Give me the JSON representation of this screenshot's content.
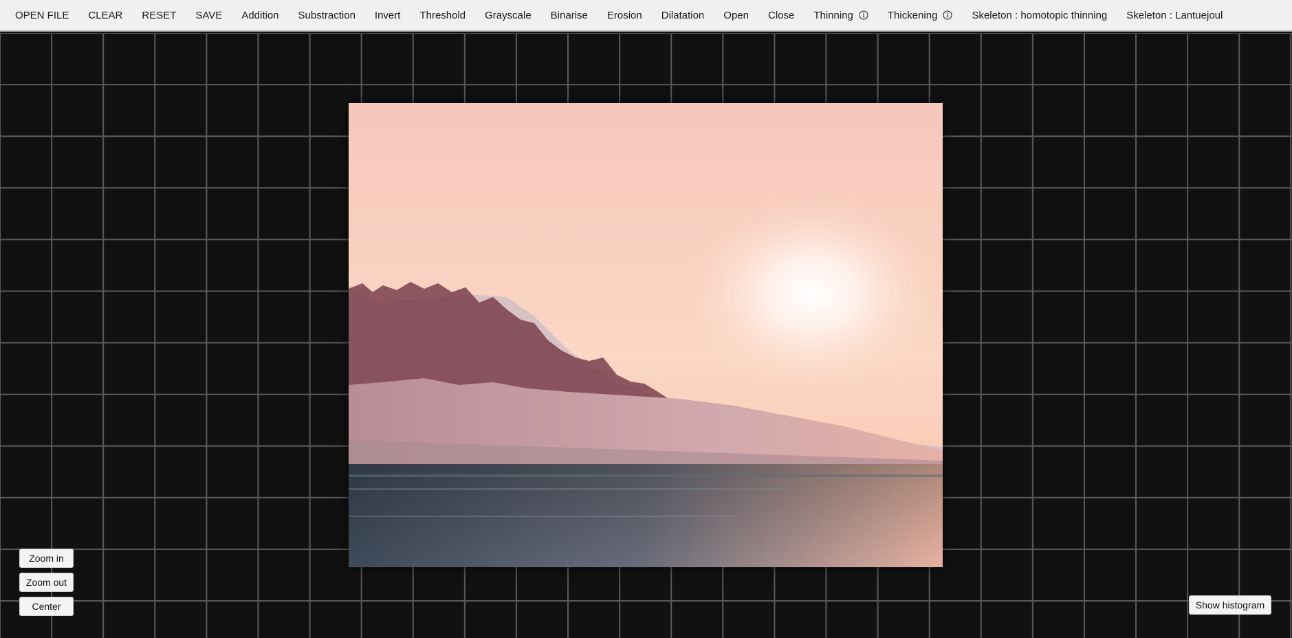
{
  "toolbar": {
    "items": [
      {
        "label": "OPEN FILE"
      },
      {
        "label": "CLEAR"
      },
      {
        "label": "RESET"
      },
      {
        "label": "SAVE"
      },
      {
        "label": "Addition"
      },
      {
        "label": "Substraction"
      },
      {
        "label": "Invert"
      },
      {
        "label": "Threshold"
      },
      {
        "label": "Grayscale"
      },
      {
        "label": "Binarise"
      },
      {
        "label": "Erosion"
      },
      {
        "label": "Dilatation"
      },
      {
        "label": "Open"
      },
      {
        "label": "Close"
      },
      {
        "label": "Thinning",
        "icon": "info-icon"
      },
      {
        "label": "Thickening",
        "icon": "info-icon"
      },
      {
        "label": "Skeleton : homotopic thinning"
      },
      {
        "label": "Skeleton : Lantuejoul"
      }
    ]
  },
  "zoom_controls": {
    "zoom_in": "Zoom in",
    "zoom_out": "Zoom out",
    "center": "Center"
  },
  "histogram_button": "Show histogram",
  "colors": {
    "toolbar_bg": "#eef0f2",
    "canvas_bg": "#111111",
    "grid_line": "#5a5a5a",
    "button_bg": "#f3f3f3"
  }
}
